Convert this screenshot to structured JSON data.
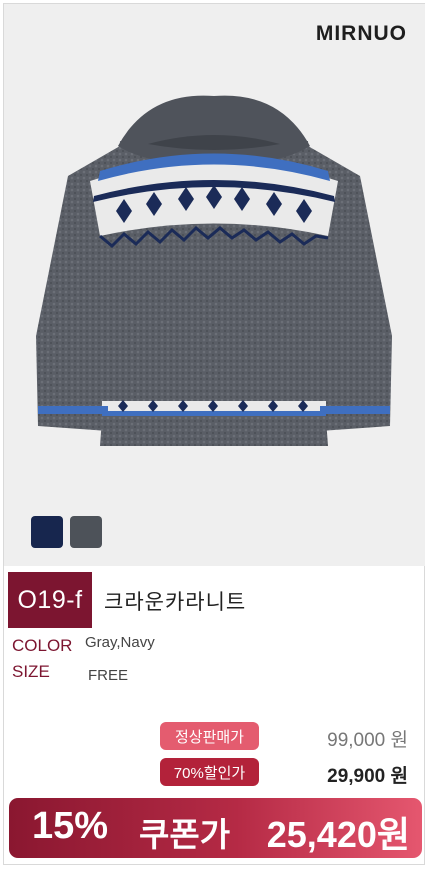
{
  "brand": "MIRNUO",
  "colors": {
    "brand_red": "#7c1530",
    "swatch_navy": "#17264e",
    "swatch_gray": "#4d5259"
  },
  "product": {
    "code": "O19-f",
    "name": "크라운카라니트",
    "color_label": "COLOR",
    "color_value": "Gray,Navy",
    "size_label": "SIZE",
    "size_value": "FREE"
  },
  "pricing": {
    "regular_label": "정상판매가",
    "regular_price": "99,000 원",
    "discount_label": "70%할인가",
    "discount_price": "29,900 원",
    "coupon_percent": "15%",
    "coupon_label": "쿠폰가",
    "coupon_price": "25,420원"
  },
  "swatches": [
    "navy",
    "gray"
  ]
}
